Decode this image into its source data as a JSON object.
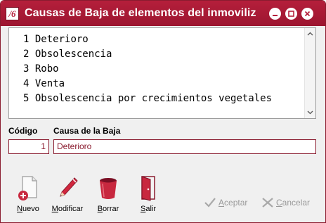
{
  "window": {
    "title": "Causas de Baja de elementos del inmoviliz",
    "app_icon_glyph": "/6"
  },
  "list": {
    "items": [
      {
        "num": "1",
        "label": "Deterioro"
      },
      {
        "num": "2",
        "label": "Obsolescencia"
      },
      {
        "num": "3",
        "label": "Robo"
      },
      {
        "num": "4",
        "label": "Venta"
      },
      {
        "num": "5",
        "label": "Obsolescencia por crecimientos vegetales"
      }
    ]
  },
  "form": {
    "codigo_label": "Código",
    "codigo_value": "1",
    "causa_label": "Causa de la Baja",
    "causa_value": "Deterioro"
  },
  "toolbar": {
    "nuevo": {
      "first": "N",
      "rest": "uevo"
    },
    "modificar": {
      "first": "M",
      "rest": "odificar"
    },
    "borrar": {
      "first": "B",
      "rest": "orrar"
    },
    "salir": {
      "first": "S",
      "rest": "alir"
    }
  },
  "actions": {
    "aceptar": {
      "first": "A",
      "rest": "ceptar"
    },
    "cancelar": {
      "first": "C",
      "rest": "ancelar"
    }
  },
  "colors": {
    "titlebar": "#b51f3b",
    "field_border": "#8a1c2f",
    "disabled_text": "#9a9a9a"
  }
}
